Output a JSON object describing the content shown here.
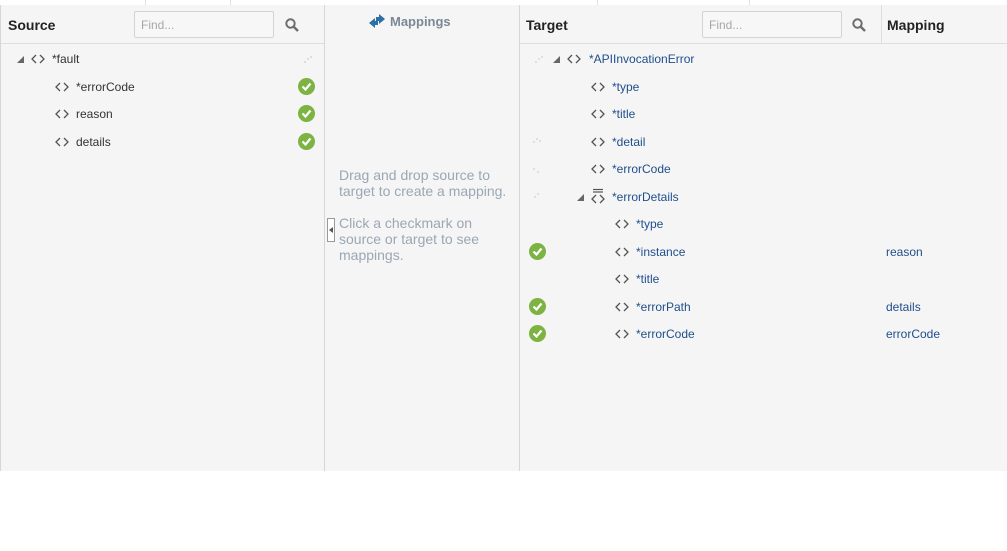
{
  "source": {
    "title": "Source",
    "search_placeholder": "Find...",
    "root": {
      "label": "*fault"
    },
    "children": [
      {
        "label": "*errorCode",
        "mapped": true
      },
      {
        "label": "reason",
        "mapped": true
      },
      {
        "label": "details",
        "mapped": true
      }
    ]
  },
  "mappings": {
    "title": "Mappings",
    "hint_drag": "Drag and drop source to target to create a mapping.",
    "hint_click": "Click a checkmark on source or target to see mappings."
  },
  "target": {
    "title": "Target",
    "search_placeholder": "Find...",
    "mapping_column_title": "Mapping",
    "root": {
      "label": "*APIInvocationError"
    },
    "level1": [
      {
        "label": "*type"
      },
      {
        "label": "*title"
      },
      {
        "label": "*detail"
      },
      {
        "label": "*errorCode"
      },
      {
        "label": "*errorDetails"
      }
    ],
    "level2": [
      {
        "label": "*type",
        "mapping": "",
        "mapped": false
      },
      {
        "label": "*instance",
        "mapping": "reason",
        "mapped": true
      },
      {
        "label": "*title",
        "mapping": "",
        "mapped": false
      },
      {
        "label": "*errorPath",
        "mapping": "details",
        "mapped": true
      },
      {
        "label": "*errorCode",
        "mapping": "errorCode",
        "mapped": true
      }
    ]
  },
  "colors": {
    "check_green": "#7cb342",
    "link_blue": "#1f4e8c",
    "hint_gray": "#9aa7b5",
    "icon_blue": "#2f6fa7"
  }
}
